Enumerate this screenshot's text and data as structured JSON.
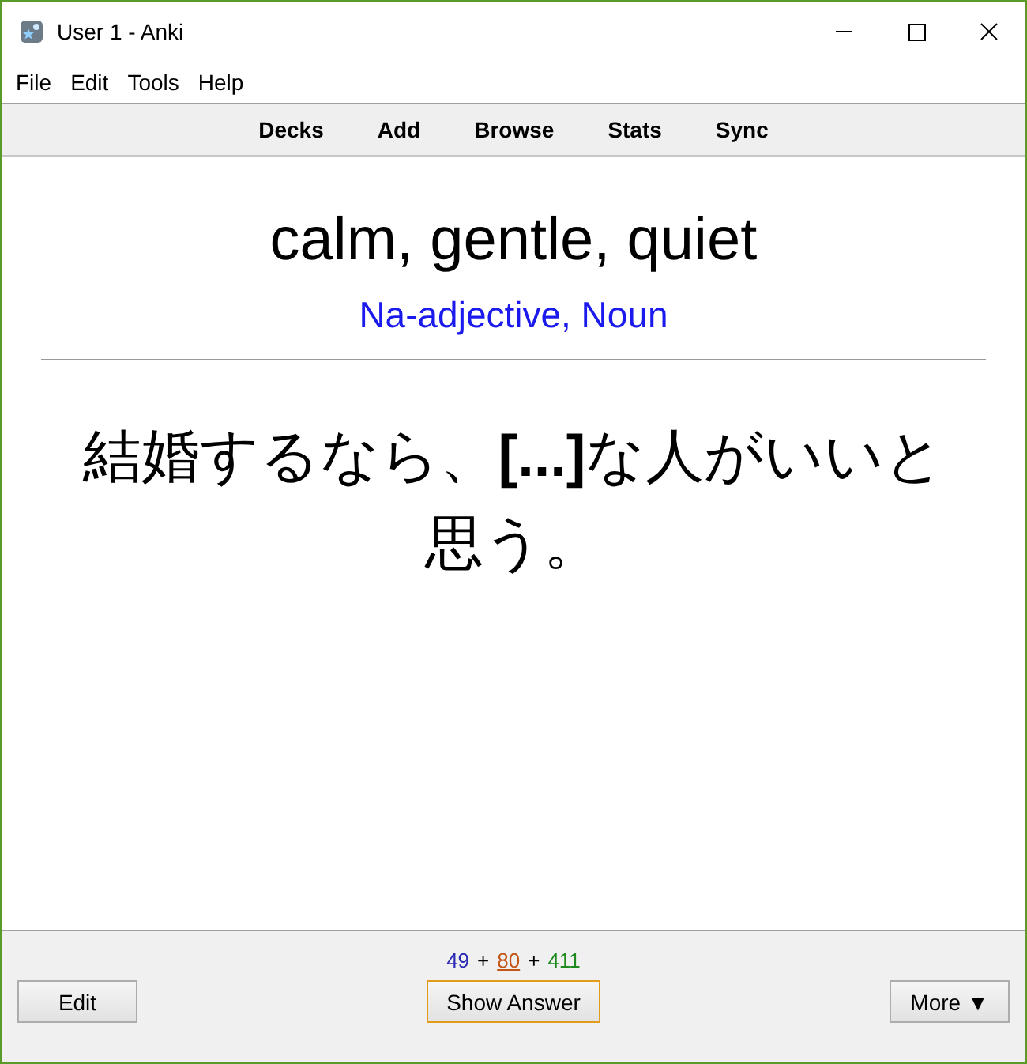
{
  "window": {
    "title": "User 1 - Anki"
  },
  "menu": [
    "File",
    "Edit",
    "Tools",
    "Help"
  ],
  "toolbar": [
    "Decks",
    "Add",
    "Browse",
    "Stats",
    "Sync"
  ],
  "card": {
    "front": "calm, gentle, quiet",
    "part_of_speech": "Na-adjective, Noun",
    "sentence": "結婚するなら、**[...]**な人がいいと思う。"
  },
  "counts": [
    {
      "value": "49",
      "color": "#2a2ab4",
      "selected": false
    },
    {
      "value": "80",
      "color": "#c35617",
      "selected": true
    },
    {
      "value": "411",
      "color": "#1c8a1c",
      "selected": false
    }
  ],
  "count_separator": "+",
  "buttons": {
    "edit": "Edit",
    "show_answer": "Show Answer",
    "more": "More",
    "more_arrow": "▼"
  }
}
